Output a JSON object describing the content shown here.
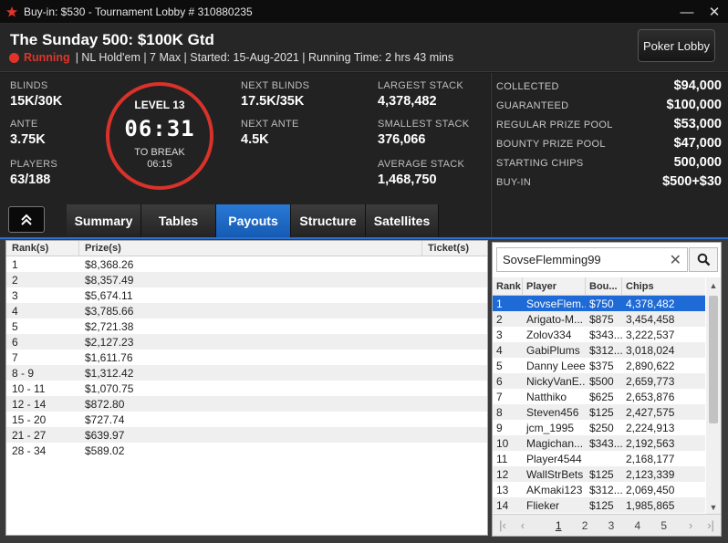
{
  "window": {
    "title": "Buy-in: $530 - Tournament Lobby # 310880235",
    "minimize_glyph": "—",
    "close_glyph": "✕"
  },
  "header": {
    "tournament_name": "The Sunday 500: $100K Gtd",
    "status": "Running",
    "details": "| NL Hold'em | 7 Max | Started: 15-Aug-2021 | Running Time: 2 hrs  43 mins",
    "lobby_button": "Poker Lobby"
  },
  "stats": {
    "blinds": {
      "label": "BLINDS",
      "value": "15K/30K"
    },
    "ante": {
      "label": "ANTE",
      "value": "3.75K"
    },
    "players": {
      "label": "PLAYERS",
      "value": "63/188"
    },
    "next_blinds": {
      "label": "NEXT BLINDS",
      "value": "17.5K/35K"
    },
    "next_ante": {
      "label": "NEXT ANTE",
      "value": "4.5K"
    },
    "largest_stack": {
      "label": "LARGEST STACK",
      "value": "4,378,482"
    },
    "smallest_stack": {
      "label": "SMALLEST STACK",
      "value": "376,066"
    },
    "average_stack": {
      "label": "AVERAGE STACK",
      "value": "1,468,750"
    }
  },
  "clock": {
    "level": "LEVEL 13",
    "time": "06:31",
    "to_break_label": "TO BREAK",
    "to_break_time": "06:15"
  },
  "prize_info": [
    {
      "label": "COLLECTED",
      "value": "$94,000"
    },
    {
      "label": "GUARANTEED",
      "value": "$100,000"
    },
    {
      "label": "REGULAR PRIZE POOL",
      "value": "$53,000"
    },
    {
      "label": "BOUNTY PRIZE POOL",
      "value": "$47,000"
    },
    {
      "label": "STARTING CHIPS",
      "value": "500,000"
    },
    {
      "label": "BUY-IN",
      "value": "$500+$30"
    }
  ],
  "tabs": [
    {
      "label": "Summary",
      "active": false
    },
    {
      "label": "Tables",
      "active": false
    },
    {
      "label": "Payouts",
      "active": true
    },
    {
      "label": "Structure",
      "active": false
    },
    {
      "label": "Satellites",
      "active": false
    }
  ],
  "payouts": {
    "columns": {
      "rank": "Rank(s)",
      "prize": "Prize(s)",
      "ticket": "Ticket(s)"
    },
    "rows": [
      {
        "rank": "1",
        "prize": "$8,368.26"
      },
      {
        "rank": "2",
        "prize": "$8,357.49"
      },
      {
        "rank": "3",
        "prize": "$5,674.11"
      },
      {
        "rank": "4",
        "prize": "$3,785.66"
      },
      {
        "rank": "5",
        "prize": "$2,721.38"
      },
      {
        "rank": "6",
        "prize": "$2,127.23"
      },
      {
        "rank": "7",
        "prize": "$1,611.76"
      },
      {
        "rank": "8 - 9",
        "prize": "$1,312.42"
      },
      {
        "rank": "10 - 11",
        "prize": "$1,070.75"
      },
      {
        "rank": "12 - 14",
        "prize": "$872.80"
      },
      {
        "rank": "15 - 20",
        "prize": "$727.74"
      },
      {
        "rank": "21 - 27",
        "prize": "$639.97"
      },
      {
        "rank": "28 - 34",
        "prize": "$589.02"
      }
    ]
  },
  "players_panel": {
    "search_value": "SovseFlemming99",
    "columns": {
      "rank": "Rank",
      "player": "Player",
      "bounty": "Bou...",
      "chips": "Chips"
    },
    "rows": [
      {
        "rank": "1",
        "player": "SovseFlem...",
        "bounty": "$750",
        "chips": "4,378,482",
        "selected": true
      },
      {
        "rank": "2",
        "player": "Arigato-M...",
        "bounty": "$875",
        "chips": "3,454,458"
      },
      {
        "rank": "3",
        "player": "Zolov334",
        "bounty": "$343...",
        "chips": "3,222,537"
      },
      {
        "rank": "4",
        "player": "GabiPlums",
        "bounty": "$312...",
        "chips": "3,018,024"
      },
      {
        "rank": "5",
        "player": "Danny Leee",
        "bounty": "$375",
        "chips": "2,890,622"
      },
      {
        "rank": "6",
        "player": "NickyVanE...",
        "bounty": "$500",
        "chips": "2,659,773"
      },
      {
        "rank": "7",
        "player": "Natthiko",
        "bounty": "$625",
        "chips": "2,653,876"
      },
      {
        "rank": "8",
        "player": "Steven456",
        "bounty": "$125",
        "chips": "2,427,575"
      },
      {
        "rank": "9",
        "player": "jcm_1995",
        "bounty": "$250",
        "chips": "2,224,913"
      },
      {
        "rank": "10",
        "player": "Magichan...",
        "bounty": "$343...",
        "chips": "2,192,563"
      },
      {
        "rank": "11",
        "player": "Player4544",
        "bounty": "",
        "chips": "2,168,177"
      },
      {
        "rank": "12",
        "player": "WallStrBets",
        "bounty": "$125",
        "chips": "2,123,339"
      },
      {
        "rank": "13",
        "player": "AKmaki123",
        "bounty": "$312...",
        "chips": "2,069,450"
      },
      {
        "rank": "14",
        "player": "Flieker",
        "bounty": "$125",
        "chips": "1,985,865"
      }
    ],
    "pages": [
      "1",
      "2",
      "3",
      "4",
      "5"
    ],
    "current_page": "1"
  },
  "colors": {
    "accent_blue": "#1e6ad6",
    "status_red": "#e0342a",
    "clock_ring": "#d8322a"
  }
}
